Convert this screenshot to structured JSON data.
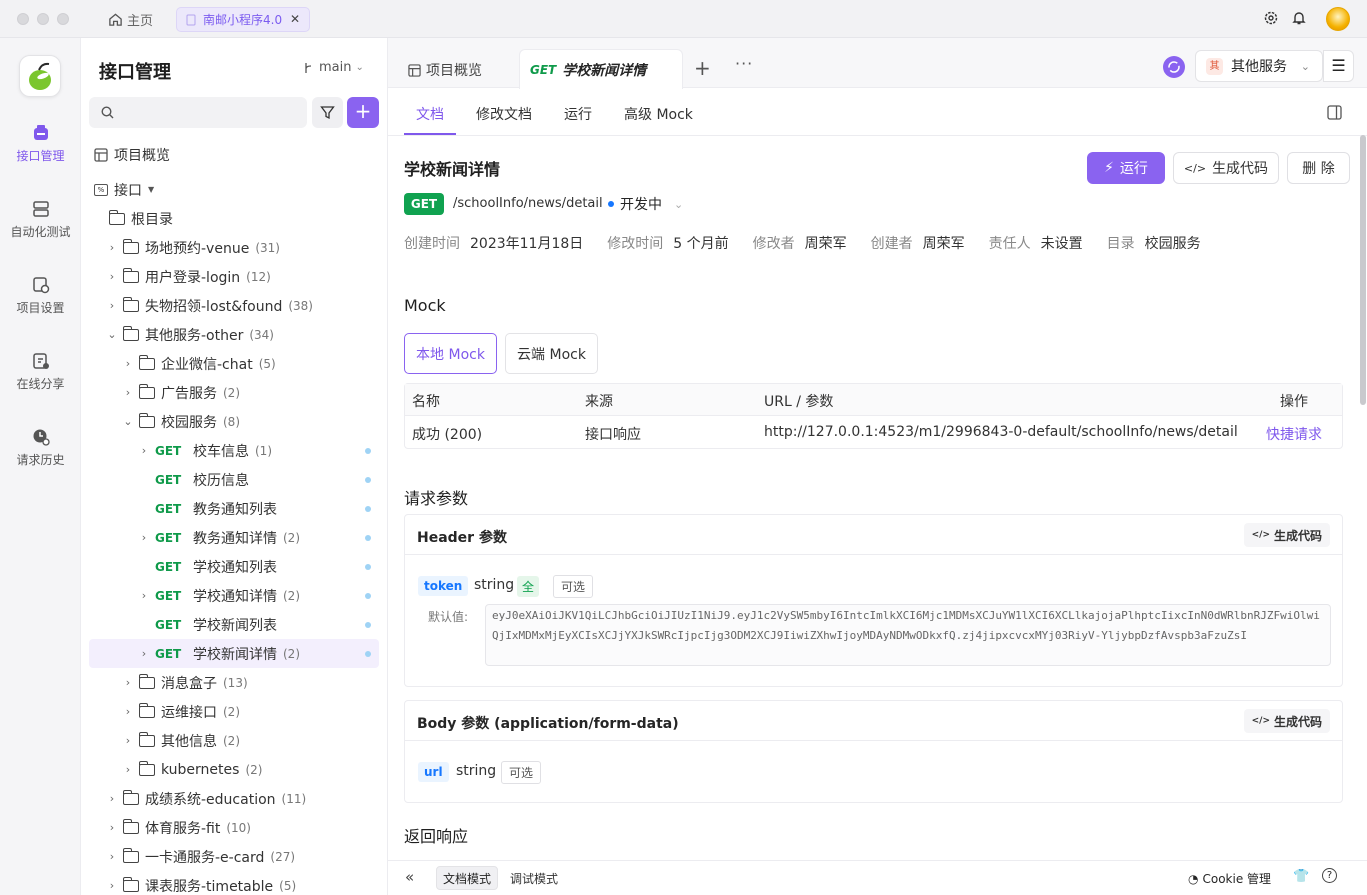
{
  "titlebar": {
    "home_label": "主页",
    "tab_label": "南邮小程序4.0"
  },
  "rail": {
    "items": [
      {
        "label": "接口管理",
        "icon": "api-icon",
        "active": true
      },
      {
        "label": "自动化测试",
        "icon": "automation-icon",
        "active": false
      },
      {
        "label": "项目设置",
        "icon": "settings-icon",
        "active": false
      },
      {
        "label": "在线分享",
        "icon": "share-icon",
        "active": false
      },
      {
        "label": "请求历史",
        "icon": "history-icon",
        "active": false
      }
    ]
  },
  "tree": {
    "title": "接口管理",
    "branch": "main",
    "search_placeholder": "",
    "overview": "项目概览",
    "api_label": "接口",
    "root": "根目录",
    "rows": [
      {
        "type": "folder",
        "level": 1,
        "label": "场地预约-venue",
        "count": "(31)",
        "chev": "›"
      },
      {
        "type": "folder",
        "level": 1,
        "label": "用户登录-login",
        "count": "(12)",
        "chev": "›"
      },
      {
        "type": "folder",
        "level": 1,
        "label": "失物招领-lost&found",
        "count": "(38)",
        "chev": "›"
      },
      {
        "type": "folder",
        "level": 1,
        "label": "其他服务-other",
        "count": "(34)",
        "chev": "⌄"
      },
      {
        "type": "folder",
        "level": 2,
        "label": "企业微信-chat",
        "count": "(5)",
        "chev": "›"
      },
      {
        "type": "folder",
        "level": 2,
        "label": "广告服务",
        "count": "(2)",
        "chev": "›"
      },
      {
        "type": "folder",
        "level": 2,
        "label": "校园服务",
        "count": "(8)",
        "chev": "⌄"
      },
      {
        "type": "api",
        "level": 3,
        "label": "校车信息",
        "count": "(1)",
        "chev": "›",
        "method": "GET"
      },
      {
        "type": "api",
        "level": 3,
        "label": "校历信息",
        "count": "",
        "chev": "",
        "method": "GET"
      },
      {
        "type": "api",
        "level": 3,
        "label": "教务通知列表",
        "count": "",
        "chev": "",
        "method": "GET"
      },
      {
        "type": "api",
        "level": 3,
        "label": "教务通知详情",
        "count": "(2)",
        "chev": "›",
        "method": "GET"
      },
      {
        "type": "api",
        "level": 3,
        "label": "学校通知列表",
        "count": "",
        "chev": "",
        "method": "GET"
      },
      {
        "type": "api",
        "level": 3,
        "label": "学校通知详情",
        "count": "(2)",
        "chev": "›",
        "method": "GET"
      },
      {
        "type": "api",
        "level": 3,
        "label": "学校新闻列表",
        "count": "",
        "chev": "",
        "method": "GET"
      },
      {
        "type": "api",
        "level": 3,
        "label": "学校新闻详情",
        "count": "(2)",
        "chev": "›",
        "method": "GET",
        "selected": true
      },
      {
        "type": "folder",
        "level": 2,
        "label": "消息盒子",
        "count": "(13)",
        "chev": "›"
      },
      {
        "type": "folder",
        "level": 2,
        "label": "运维接口",
        "count": "(2)",
        "chev": "›"
      },
      {
        "type": "folder",
        "level": 2,
        "label": "其他信息",
        "count": "(2)",
        "chev": "›"
      },
      {
        "type": "folder",
        "level": 2,
        "label": "kubernetes",
        "count": "(2)",
        "chev": "›"
      },
      {
        "type": "folder",
        "level": 1,
        "label": "成绩系统-education",
        "count": "(11)",
        "chev": "›"
      },
      {
        "type": "folder",
        "level": 1,
        "label": "体育服务-fit",
        "count": "(10)",
        "chev": "›"
      },
      {
        "type": "folder",
        "level": 1,
        "label": "一卡通服务-e-card",
        "count": "(27)",
        "chev": "›"
      },
      {
        "type": "folder",
        "level": 1,
        "label": "课表服务-timetable",
        "count": "(5)",
        "chev": "›"
      }
    ]
  },
  "tabs": {
    "overview": "项目概览",
    "active_method": "GET",
    "active_title": "学校新闻详情"
  },
  "env": {
    "badge": "其",
    "label": "其他服务"
  },
  "subtabs": [
    "文档",
    "修改文档",
    "运行",
    "高级 Mock"
  ],
  "doc": {
    "title": "学校新闻详情",
    "run_label": "运行",
    "gen_label": "生成代码",
    "delete_label": "删 除",
    "method": "GET",
    "path": "/schoolInfo/news/detail",
    "status": "开发中",
    "meta": [
      {
        "k": "创建时间",
        "v": "2023年11月18日"
      },
      {
        "k": "修改时间",
        "v": "5 个月前"
      },
      {
        "k": "修改者",
        "v": "周荣军"
      },
      {
        "k": "创建者",
        "v": "周荣军"
      },
      {
        "k": "责任人",
        "v": "未设置"
      },
      {
        "k": "目录",
        "v": "校园服务"
      }
    ]
  },
  "mock": {
    "section": "Mock",
    "local": "本地 Mock",
    "cloud": "云端 Mock",
    "headers": [
      "名称",
      "来源",
      "URL / 参数",
      "操作"
    ],
    "row": {
      "name": "成功 (200)",
      "source": "接口响应",
      "url": "http://127.0.0.1:4523/m1/2996843-0-default/schoolInfo/news/detail",
      "action": "快捷请求"
    }
  },
  "params": {
    "section": "请求参数",
    "header_title": "Header 参数",
    "gen_label": "生成代码",
    "header_param": {
      "name": "token",
      "type": "string",
      "all_tag": "全",
      "opt_tag": "可选",
      "default_label": "默认值:",
      "default_value": "eyJ0eXAiOiJKV1QiLCJhbGciOiJIUzI1NiJ9.eyJ1c2VySW5mbyI6IntcImlkXCI6Mjc1MDMsXCJuYW1lXCI6XCLlkajojaPlhptcIixcInN0dWRlbnRJZFwiOlwiQjIxMDMxMjEyXCIsXCJjYXJkSWRcIjpcIjg3ODM2XCJ9IiwiZXhwIjoyMDAyNDMwODkxfQ.zj4jipxcvcxMYj03RiyV-YljybpDzfAvspb3aFzuZsI"
    },
    "body_title": "Body 参数 (application/form-data)",
    "body_param": {
      "name": "url",
      "type": "string",
      "opt_tag": "可选"
    }
  },
  "response": {
    "section": "返回响应"
  },
  "bottom": {
    "doc_mode": "文档模式",
    "debug_mode": "调试模式",
    "cookie": "Cookie 管理"
  }
}
